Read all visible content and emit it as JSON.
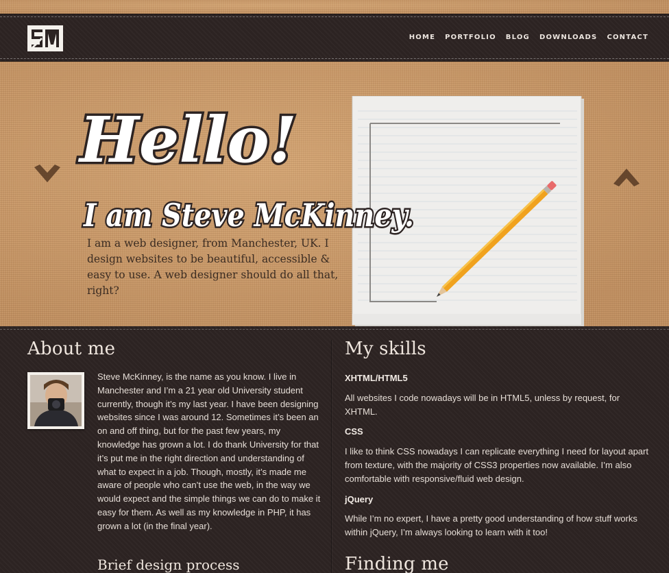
{
  "header": {
    "logo_alt": "SM logo",
    "nav": [
      {
        "label": "HOME"
      },
      {
        "label": "PORTFOLIO"
      },
      {
        "label": "BLOG"
      },
      {
        "label": "DOWNLOADS"
      },
      {
        "label": "CONTACT"
      }
    ]
  },
  "hero": {
    "greeting": "Hello!",
    "intro": "I am Steve McKinney.",
    "blurb": "I am a web designer, from Manchester, UK. I design websites to be beautiful, accessible & easy to use. A web designer should do all that, right?",
    "icons": {
      "prev": "chevron-down-icon",
      "next": "chevron-up-icon",
      "illustration": "notepad-pencil-icon"
    }
  },
  "about": {
    "title": "About me",
    "text": "Steve McKinney, is the name as you know. I live in Manchester and I’m a 21 year old University student currently, though it’s my last year. I have been designing websites since I was around 12. Sometimes it’s been an on and off thing, but for the past few years, my knowledge has grown a lot. I do thank University for that it’s put me in the right direction and understanding of what to expect in a job. Though, mostly, it’s made me aware of people who can’t use the web, in the way we would expect and the simple things we can do to make it easy for them. As well as my knowledge in PHP, it has grown a lot (in the final year).",
    "subheading": "Brief design process"
  },
  "skills": {
    "title": "My skills",
    "items": [
      {
        "name": "XHTML/HTML5",
        "desc": "All websites I code nowadays will be in HTML5, unless by request, for XHTML."
      },
      {
        "name": "CSS",
        "desc": "I like to think CSS nowadays I can replicate everything I need for layout apart from texture, with the majority of CSS3 properties now available. I’m also comfortable with responsive/fluid web design."
      },
      {
        "name": "jQuery",
        "desc": "While I’m no expert, I have a pretty good understanding of how stuff works within jQuery, I’m always looking to learn with it too!"
      }
    ],
    "finding_title": "Finding me"
  },
  "colors": {
    "burlap": "#c9996a",
    "dark": "#2c2322",
    "text_light": "#e6ded7",
    "pencil": "#f0a21e"
  }
}
